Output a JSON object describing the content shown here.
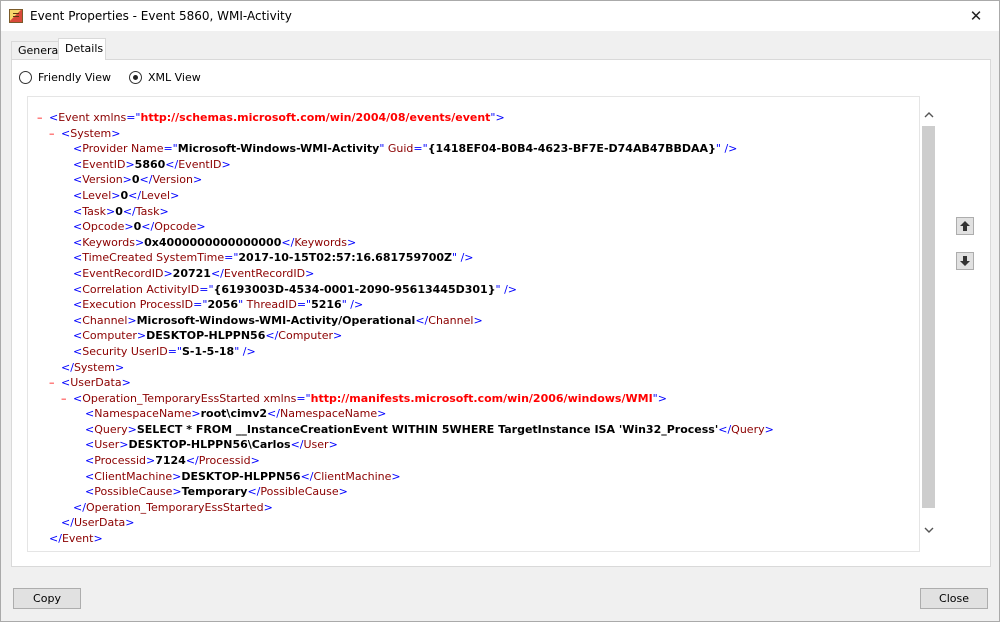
{
  "window": {
    "title": "Event Properties - Event 5860, WMI-Activity",
    "close_glyph": "✕"
  },
  "tabs": [
    {
      "label": "General",
      "active": false
    },
    {
      "label": "Details",
      "active": true
    }
  ],
  "view_options": {
    "friendly_label": "Friendly View",
    "xml_label": "XML View",
    "selected": "XML View"
  },
  "xml": {
    "event_open": {
      "name": "Event",
      "attr": "xmlns",
      "value": "http://schemas.microsoft.com/win/2004/08/events/event"
    },
    "system_tag": "System",
    "provider": {
      "name": "Provider",
      "attr1": "Name",
      "val1": "Microsoft-Windows-WMI-Activity",
      "attr2": "Guid",
      "val2": "{1418EF04-B0B4-4623-BF7E-D74AB47BBDAA}"
    },
    "event_id": {
      "name": "EventID",
      "value": "5860"
    },
    "version": {
      "name": "Version",
      "value": "0"
    },
    "level": {
      "name": "Level",
      "value": "0"
    },
    "task": {
      "name": "Task",
      "value": "0"
    },
    "opcode": {
      "name": "Opcode",
      "value": "0"
    },
    "keywords": {
      "name": "Keywords",
      "value": "0x4000000000000000"
    },
    "time_created": {
      "name": "TimeCreated",
      "attr": "SystemTime",
      "value": "2017-10-15T02:57:16.681759700Z"
    },
    "event_record_id": {
      "name": "EventRecordID",
      "value": "20721"
    },
    "correlation": {
      "name": "Correlation",
      "attr": "ActivityID",
      "value": "{6193003D-4534-0001-2090-95613445D301}"
    },
    "execution": {
      "name": "Execution",
      "attr1": "ProcessID",
      "val1": "2056",
      "attr2": "ThreadID",
      "val2": "5216"
    },
    "channel": {
      "name": "Channel",
      "value": "Microsoft-Windows-WMI-Activity/Operational"
    },
    "computer": {
      "name": "Computer",
      "value": "DESKTOP-HLPPN56"
    },
    "security": {
      "name": "Security",
      "attr": "UserID",
      "value": "S-1-5-18"
    },
    "userdata_tag": "UserData",
    "operation": {
      "name": "Operation_TemporaryEssStarted",
      "attr": "xmlns",
      "value": "http://manifests.microsoft.com/win/2006/windows/WMI"
    },
    "namespace_name": {
      "name": "NamespaceName",
      "value": "root\\cimv2"
    },
    "query": {
      "name": "Query",
      "value": "SELECT * FROM __InstanceCreationEvent WITHIN 5WHERE TargetInstance ISA 'Win32_Process'"
    },
    "user": {
      "name": "User",
      "value": "DESKTOP-HLPPN56\\Carlos"
    },
    "processid": {
      "name": "Processid",
      "value": "7124"
    },
    "client_machine": {
      "name": "ClientMachine",
      "value": "DESKTOP-HLPPN56"
    },
    "possible_cause": {
      "name": "PossibleCause",
      "value": "Temporary"
    }
  },
  "buttons": {
    "copy": "Copy",
    "close": "Close"
  },
  "colors": {
    "tag": "#8b0000",
    "bracket": "#0000ff",
    "namespace_value": "#ff0000",
    "collapse_minus": "#ff0000"
  }
}
